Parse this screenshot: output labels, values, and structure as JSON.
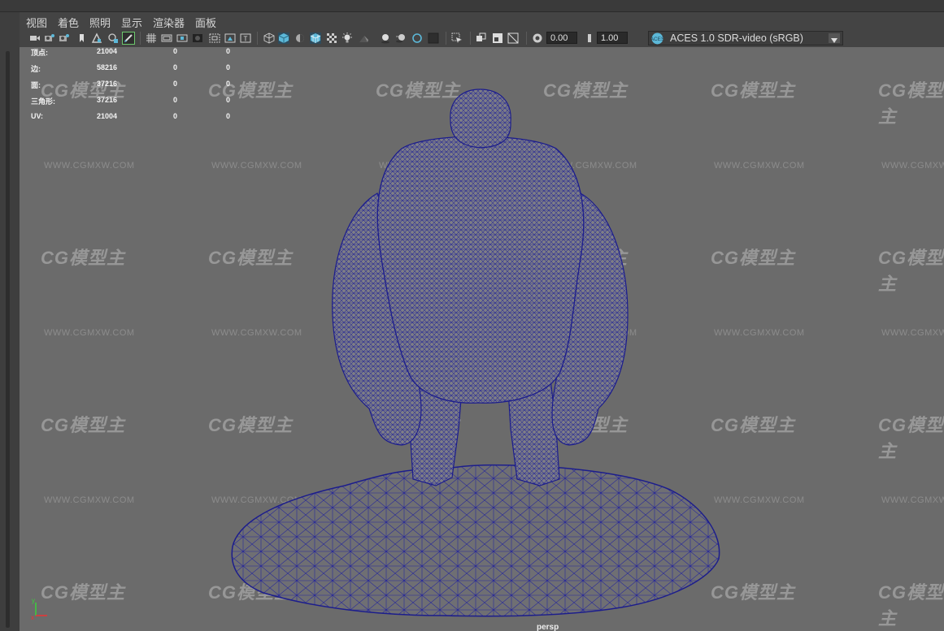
{
  "menu": {
    "items": [
      "视图",
      "着色",
      "照明",
      "显示",
      "渲染器",
      "面板"
    ]
  },
  "toolbar": {
    "exposure_value": "0.00",
    "gamma_value": "1.00",
    "color_space": "ACES 1.0 SDR-video (sRGB)",
    "icons": [
      "select-camera-icon",
      "camera-attributes-icon",
      "bookmark-icon",
      "image-plane-icon",
      "2d-pan-zoom-icon",
      "grease-pencil-icon",
      "grid-icon",
      "film-gate-icon",
      "resolution-gate-icon",
      "gate-mask-icon",
      "field-chart-icon",
      "safe-action-icon",
      "safe-title-icon",
      "wireframe-icon",
      "smooth-shade-icon",
      "default-material-icon",
      "wireframe-on-shaded-icon",
      "xray-icon",
      "use-all-lights-icon",
      "shadows-icon",
      "screen-space-ao-icon",
      "motion-blur-icon",
      "anti-aliasing-icon",
      "depth-of-field-icon",
      "isolate-select-icon",
      "xray-joints-icon",
      "backface-culling-icon",
      "exposure-icon",
      "gamma-icon",
      "color-management-icon"
    ]
  },
  "hud": {
    "rows": [
      {
        "label": "顶点:",
        "v1": "21004",
        "v2": "0",
        "v3": "0"
      },
      {
        "label": "边:",
        "v1": "58216",
        "v2": "0",
        "v3": "0"
      },
      {
        "label": "面:",
        "v1": "37216",
        "v2": "0",
        "v3": "0"
      },
      {
        "label": "三角形:",
        "v1": "37216",
        "v2": "0",
        "v3": "0"
      },
      {
        "label": "UV:",
        "v1": "21004",
        "v2": "0",
        "v3": "0"
      }
    ]
  },
  "watermark": {
    "logo": "CG模型主",
    "url": "WWW.CGMXW.COM"
  },
  "viewport": {
    "camera": "persp",
    "axis_x": "x",
    "axis_y": "y"
  },
  "colors": {
    "viewport_bg": "#6b6b6b",
    "wire": "#1c1d8c",
    "active_icon": "#5cb8d8"
  }
}
